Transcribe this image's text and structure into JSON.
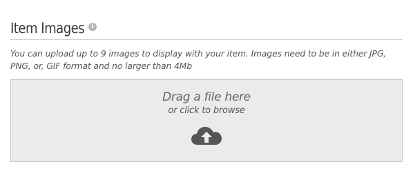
{
  "section": {
    "title": "Item Images",
    "info_icon": "info-icon",
    "info_glyph": "i",
    "description": "You can upload up to 9 images to display with your item. Images need to be in either JPG, PNG, or, GIF format and no larger than 4Mb"
  },
  "dropzone": {
    "primary_text": "Drag a file here",
    "secondary_text": "or click to browse",
    "icon": "cloud-upload-icon"
  },
  "colors": {
    "dropzone_bg": "#ebebeb",
    "dropzone_border": "#c9c9c9",
    "icon": "#555555"
  }
}
